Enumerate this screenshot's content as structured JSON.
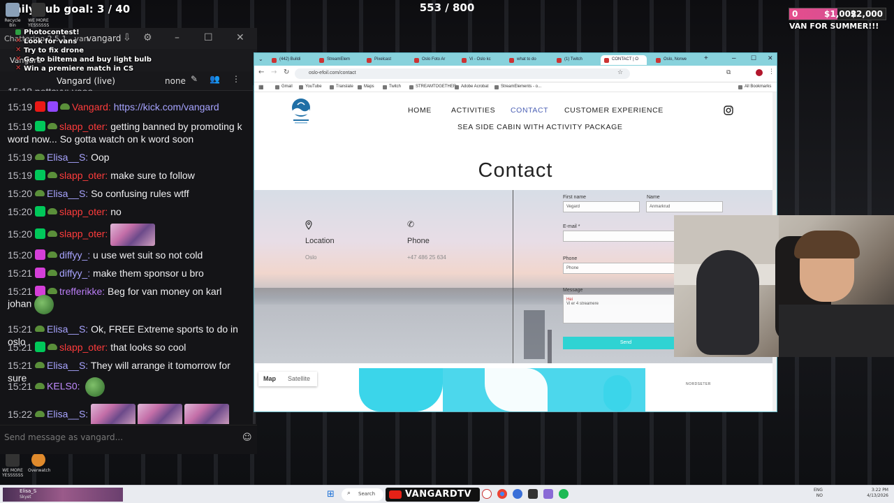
{
  "overlay": {
    "sub_goal": "Daily sub goal: 3 / 40",
    "counter": "553 / 800",
    "donation_left": "0",
    "donation_mid": "$1,002",
    "donation_right": "$2,000",
    "donation_progress": 0.5,
    "van_label": "VAN FOR SUMMER!!!",
    "checklist": [
      {
        "text": "Photocontest!",
        "done": true
      },
      {
        "text": "Look for vans",
        "done": false
      },
      {
        "text": "Try to fix drone",
        "done": false
      },
      {
        "text": "Go to biltema and buy light bulb",
        "done": false
      },
      {
        "text": "Win a premiere match in CS",
        "done": false
      }
    ]
  },
  "desktop": {
    "icons": [
      {
        "label": "Recycle Bin"
      },
      {
        "label": "WE MORE YESSSSSS"
      },
      {
        "label": "WE MORE YESSSSSS"
      },
      {
        "label": "Overwatch"
      }
    ]
  },
  "chat": {
    "window_title": "Chatterino 2.5.1 - vangard",
    "channel_user": "vangard",
    "tab_label": "Vangard",
    "channel_header": "Vangard (live)",
    "mode": "none",
    "partial_top": "15:18   pettayy: yooo",
    "messages": [
      {
        "time": "15:19",
        "user": "Vangard:",
        "text": "https://kick.com/vangard",
        "ucls": "u-red",
        "badge": "bg-red",
        "badge2": "bg-purple",
        "link": true
      },
      {
        "time": "15:19",
        "user": "slapp_oter:",
        "text": "getting banned by promoting k word now... So gotta watch on k word soon",
        "ucls": "u-red",
        "badge": "bg-green"
      },
      {
        "time": "15:19",
        "user": "Elisa__S:",
        "text": "Oop",
        "ucls": "u-blue",
        "badge": ""
      },
      {
        "time": "15:19",
        "user": "slapp_oter:",
        "text": "make sure to follow",
        "ucls": "u-red",
        "badge": "bg-green"
      },
      {
        "time": "15:20",
        "user": "Elisa__S:",
        "text": "So confusing rules wtff",
        "ucls": "u-blue",
        "badge": ""
      },
      {
        "time": "15:20",
        "user": "slapp_oter:",
        "text": "no",
        "ucls": "u-red",
        "badge": "bg-green"
      },
      {
        "time": "15:20",
        "user": "slapp_oter:",
        "text": "",
        "ucls": "u-red",
        "badge": "bg-green",
        "emote": 1
      },
      {
        "time": "15:20",
        "user": "diffyy_:",
        "text": "u use wet suit so not cold",
        "ucls": "u-blue",
        "badge": "bg-pink"
      },
      {
        "time": "15:21",
        "user": "diffyy_:",
        "text": "make them sponsor u bro",
        "ucls": "u-blue",
        "badge": "bg-pink"
      },
      {
        "time": "15:21",
        "user": "trefferikke:",
        "text": "Beg for van money on karl",
        "ucls": "u-purple",
        "badge": "bg-pink"
      },
      {
        "time": "",
        "user": "",
        "text": "johan",
        "ucls": "",
        "badge": "",
        "pepe": true
      },
      {
        "time": "15:21",
        "user": "Elisa__S:",
        "text": "Ok, FREE Extreme sports to do in oslo",
        "ucls": "u-blue",
        "badge": ""
      },
      {
        "time": "15:21",
        "user": "slapp_oter:",
        "text": "that looks so cool",
        "ucls": "u-red",
        "badge": "bg-green"
      },
      {
        "time": "15:21",
        "user": "Elisa__S:",
        "text": "They will arrange it tomorrow for sure",
        "ucls": "u-blue",
        "badge": ""
      },
      {
        "time": "15:21",
        "user": "KELS0:",
        "text": "",
        "ucls": "u-kels",
        "badge": "",
        "pepe": true
      },
      {
        "time": "15:22",
        "user": "Elisa__S:",
        "text": "",
        "ucls": "u-blue",
        "badge": "",
        "emote": 3
      }
    ],
    "input_placeholder": "Send message as vangard..."
  },
  "browser": {
    "tabs": [
      "(442) Buildi",
      "StreamElem",
      "Pixelcast",
      "Oslo Foto Ar",
      "Vi - Oslo kc",
      "what to do",
      "(1) Twitch",
      "CONTACT | O",
      "Oslo, Norwe"
    ],
    "active_tab": 7,
    "url": "oslo-efoil.com/contact",
    "bookmarks": [
      "Gmail",
      "YouTube",
      "Translate",
      "Maps",
      "Twitch",
      "STREAMTOGETHER",
      "Adobe Acrobat",
      "StreamElements - o..."
    ],
    "all_bookmarks": "All Bookmarks"
  },
  "site": {
    "nav": [
      "HOME",
      "ACTIVITIES",
      "CONTACT",
      "CUSTOMER EXPERIENCE"
    ],
    "nav2": "SEA SIDE CABIN WITH ACTIVITY PACKAGE",
    "active_nav": 2,
    "heading": "Contact",
    "location_label": "Location",
    "location_value": "Oslo",
    "phone_label": "Phone",
    "phone_value": "+47 486 25 634",
    "form": {
      "first_name_label": "First name",
      "first_name_value": "Vegard",
      "name_label": "Name",
      "name_value": "Anmarkrud",
      "email_label": "E-mail *",
      "phone_label": "Phone",
      "phone_placeholder": "Phone",
      "message_label": "Message",
      "message_line1": "Hei",
      "message_line2": "Vi er 4 streamere",
      "send_label": "Send"
    },
    "map_tab": "Map",
    "satellite_tab": "Satellite",
    "map_place": "NORDSETER"
  },
  "taskbar": {
    "search": "Search",
    "brand": "VANGARDTV",
    "lang": "ENG",
    "lang2": "NO",
    "time": "3:22 PM",
    "date": "4/13/2026",
    "chat_user": "Elisa_S",
    "chat_sub": "Skyet"
  },
  "colors": {
    "accent_site": "#2fd3d3",
    "nav_active": "#4a5fb4",
    "browser_frame": "#88d2dc"
  }
}
